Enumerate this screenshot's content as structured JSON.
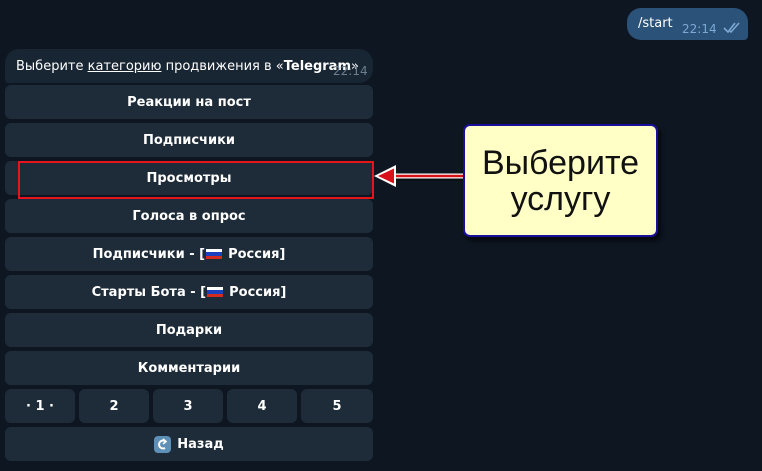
{
  "outgoing": {
    "text": "/start",
    "time": "22:14"
  },
  "incoming": {
    "text_before": "Выберите ",
    "text_link": "категорию",
    "text_middle": " продвижения в «",
    "text_bold": "Telegram",
    "text_after": "»",
    "time": "22:14"
  },
  "keyboard": {
    "reactions": "Реакции на пост",
    "subscribers": "Подписчики",
    "views": "Просмотры",
    "votes": "Голоса в опрос",
    "subscribers_ru_prefix": "Подписчики - [",
    "subscribers_ru_suffix": " Россия]",
    "bot_starts_prefix": "Старты Бота - [",
    "bot_starts_suffix": " Россия]",
    "gifts": "Подарки",
    "comments": "Комментарии",
    "pages": [
      "· 1 ·",
      "2",
      "3",
      "4",
      "5"
    ],
    "back": "Назад"
  },
  "callout": {
    "line1": "Выберите",
    "line2": "услугу"
  },
  "colors": {
    "background": "#0e1621",
    "outgoing_bubble": "#2b5278",
    "incoming_bubble": "#182533",
    "button": "#1e2c3a",
    "highlight": "#e8141b",
    "callout_fill": "#ffffc6",
    "callout_border": "#1a0f9a"
  }
}
